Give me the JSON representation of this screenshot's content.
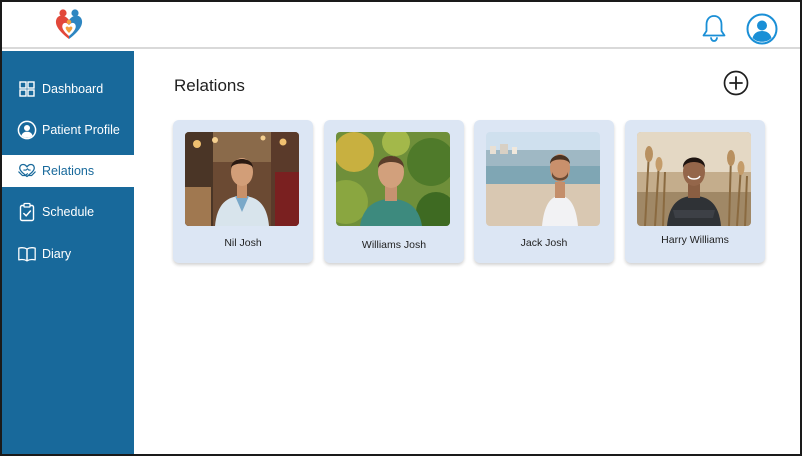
{
  "nav": {
    "items": [
      {
        "label": "Dashboard",
        "icon": "dashboard-grid-icon"
      },
      {
        "label": "Patient Profile",
        "icon": "user-circle-icon"
      },
      {
        "label": "Relations",
        "icon": "heart-hands-icon",
        "active": true
      },
      {
        "label": "Schedule",
        "icon": "clipboard-check-icon"
      },
      {
        "label": "Diary",
        "icon": "open-book-icon"
      }
    ]
  },
  "main": {
    "title": "Relations",
    "cards": [
      {
        "name": "Nil Josh"
      },
      {
        "name": "Williams Josh"
      },
      {
        "name": "Jack Josh"
      },
      {
        "name": "Harry Williams"
      }
    ]
  },
  "colors": {
    "sidebar": "#18699b",
    "card": "#dce6f4",
    "accent": "#1a8fd6",
    "logo_red": "#e2483a",
    "logo_blue": "#2e86c1"
  }
}
